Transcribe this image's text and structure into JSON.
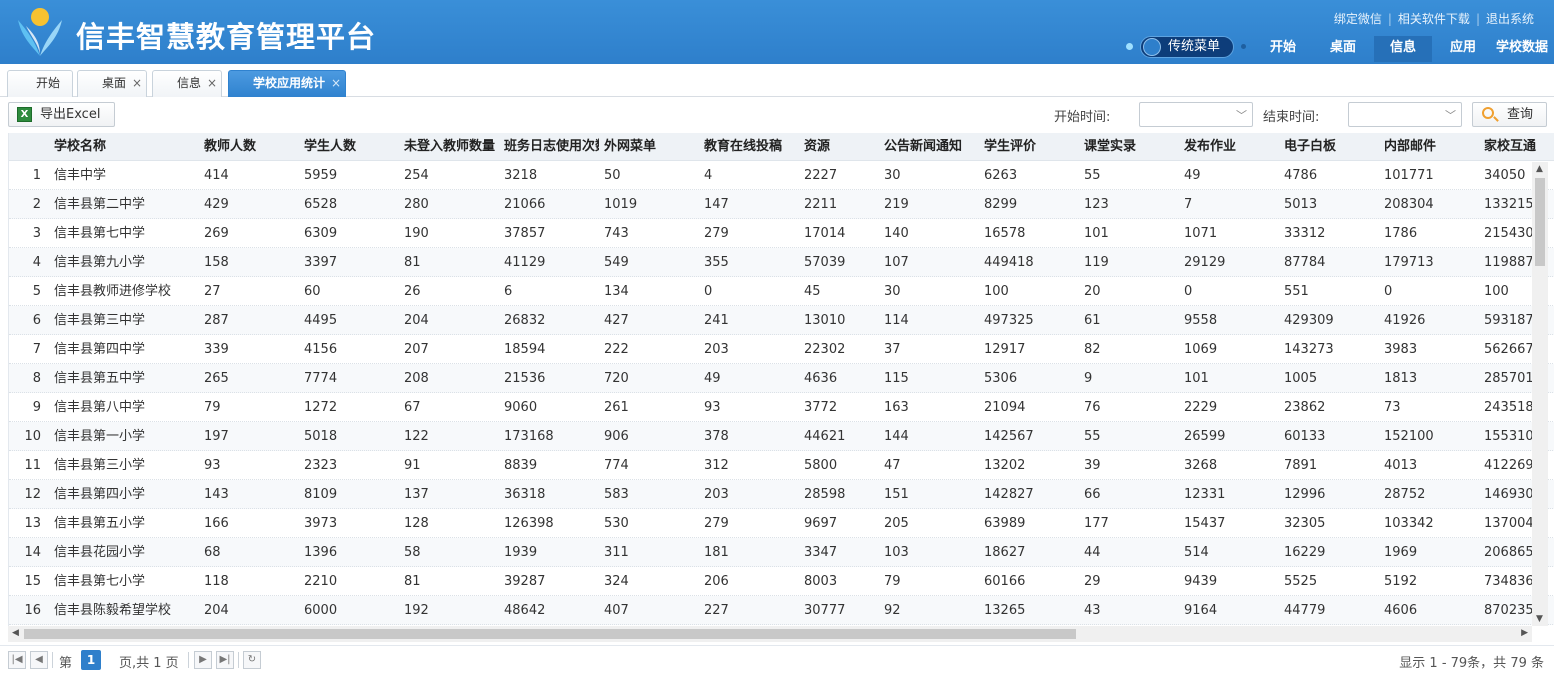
{
  "header": {
    "title": "信丰智慧教育管理平台",
    "top_links": [
      "绑定微信",
      "相关软件下载",
      "退出系统"
    ],
    "menu_toggle": "传统菜单",
    "nav": [
      {
        "label": "开始",
        "active": false
      },
      {
        "label": "桌面",
        "active": false
      },
      {
        "label": "信息",
        "active": true
      },
      {
        "label": "应用",
        "active": false
      },
      {
        "label": "学校数据",
        "active": false
      }
    ],
    "colors": {
      "bar": "#2e7fcb",
      "active_nav": "#2670b8"
    }
  },
  "tabs": [
    {
      "label": "开始",
      "closable": false,
      "active": false
    },
    {
      "label": "桌面",
      "closable": true,
      "active": false
    },
    {
      "label": "信息",
      "closable": true,
      "active": false
    },
    {
      "label": "学校应用统计",
      "closable": true,
      "active": true
    }
  ],
  "toolbar": {
    "export_label": "导出Excel",
    "start_label": "开始时间:",
    "start_value": "",
    "end_label": "结束时间:",
    "end_value": "",
    "search_label": "查询"
  },
  "table": {
    "columns": [
      "学校名称",
      "教师人数",
      "学生人数",
      "未登入教师数量",
      "班务日志使用次数",
      "外网菜单",
      "教育在线投稿",
      "资源",
      "公告新闻通知",
      "学生评价",
      "课堂实录",
      "发布作业",
      "电子白板",
      "内部邮件",
      "家校互通"
    ],
    "rows": [
      [
        "1",
        "信丰中学",
        "414",
        "5959",
        "254",
        "3218",
        "50",
        "4",
        "2227",
        "30",
        "6263",
        "55",
        "49",
        "4786",
        "101771",
        "34050"
      ],
      [
        "2",
        "信丰县第二中学",
        "429",
        "6528",
        "280",
        "21066",
        "1019",
        "147",
        "2211",
        "219",
        "8299",
        "123",
        "7",
        "5013",
        "208304",
        "133215"
      ],
      [
        "3",
        "信丰县第七中学",
        "269",
        "6309",
        "190",
        "37857",
        "743",
        "279",
        "17014",
        "140",
        "16578",
        "101",
        "1071",
        "33312",
        "1786",
        "215430"
      ],
      [
        "4",
        "信丰县第九小学",
        "158",
        "3397",
        "81",
        "41129",
        "549",
        "355",
        "57039",
        "107",
        "449418",
        "119",
        "29129",
        "87784",
        "179713",
        "119887"
      ],
      [
        "5",
        "信丰县教师进修学校",
        "27",
        "60",
        "26",
        "6",
        "134",
        "0",
        "45",
        "30",
        "100",
        "20",
        "0",
        "551",
        "0",
        "100"
      ],
      [
        "6",
        "信丰县第三中学",
        "287",
        "4495",
        "204",
        "26832",
        "427",
        "241",
        "13010",
        "114",
        "497325",
        "61",
        "9558",
        "429309",
        "41926",
        "593187"
      ],
      [
        "7",
        "信丰县第四中学",
        "339",
        "4156",
        "207",
        "18594",
        "222",
        "203",
        "22302",
        "37",
        "12917",
        "82",
        "1069",
        "143273",
        "3983",
        "562667"
      ],
      [
        "8",
        "信丰县第五中学",
        "265",
        "7774",
        "208",
        "21536",
        "720",
        "49",
        "4636",
        "115",
        "5306",
        "9",
        "101",
        "1005",
        "1813",
        "285701"
      ],
      [
        "9",
        "信丰县第八中学",
        "79",
        "1272",
        "67",
        "9060",
        "261",
        "93",
        "3772",
        "163",
        "21094",
        "76",
        "2229",
        "23862",
        "73",
        "243518"
      ],
      [
        "10",
        "信丰县第一小学",
        "197",
        "5018",
        "122",
        "173168",
        "906",
        "378",
        "44621",
        "144",
        "142567",
        "55",
        "26599",
        "60133",
        "152100",
        "155310"
      ],
      [
        "11",
        "信丰县第三小学",
        "93",
        "2323",
        "91",
        "8839",
        "774",
        "312",
        "5800",
        "47",
        "13202",
        "39",
        "3268",
        "7891",
        "4013",
        "412269"
      ],
      [
        "12",
        "信丰县第四小学",
        "143",
        "8109",
        "137",
        "36318",
        "583",
        "203",
        "28598",
        "151",
        "142827",
        "66",
        "12331",
        "12996",
        "28752",
        "146930"
      ],
      [
        "13",
        "信丰县第五小学",
        "166",
        "3973",
        "128",
        "126398",
        "530",
        "279",
        "9697",
        "205",
        "63989",
        "177",
        "15437",
        "32305",
        "103342",
        "137004"
      ],
      [
        "14",
        "信丰县花园小学",
        "68",
        "1396",
        "58",
        "1939",
        "311",
        "181",
        "3347",
        "103",
        "18627",
        "44",
        "514",
        "16229",
        "1969",
        "206865"
      ],
      [
        "15",
        "信丰县第七小学",
        "118",
        "2210",
        "81",
        "39287",
        "324",
        "206",
        "8003",
        "79",
        "60166",
        "29",
        "9439",
        "5525",
        "5192",
        "734836"
      ],
      [
        "16",
        "信丰县陈毅希望学校",
        "204",
        "6000",
        "192",
        "48642",
        "407",
        "227",
        "30777",
        "92",
        "13265",
        "43",
        "9164",
        "44779",
        "4606",
        "870235"
      ]
    ]
  },
  "pager": {
    "page_prefix": "第",
    "page_value": "1",
    "page_suffix": "页,共 1 页",
    "info": "显示 1 - 79条，共 79 条"
  }
}
